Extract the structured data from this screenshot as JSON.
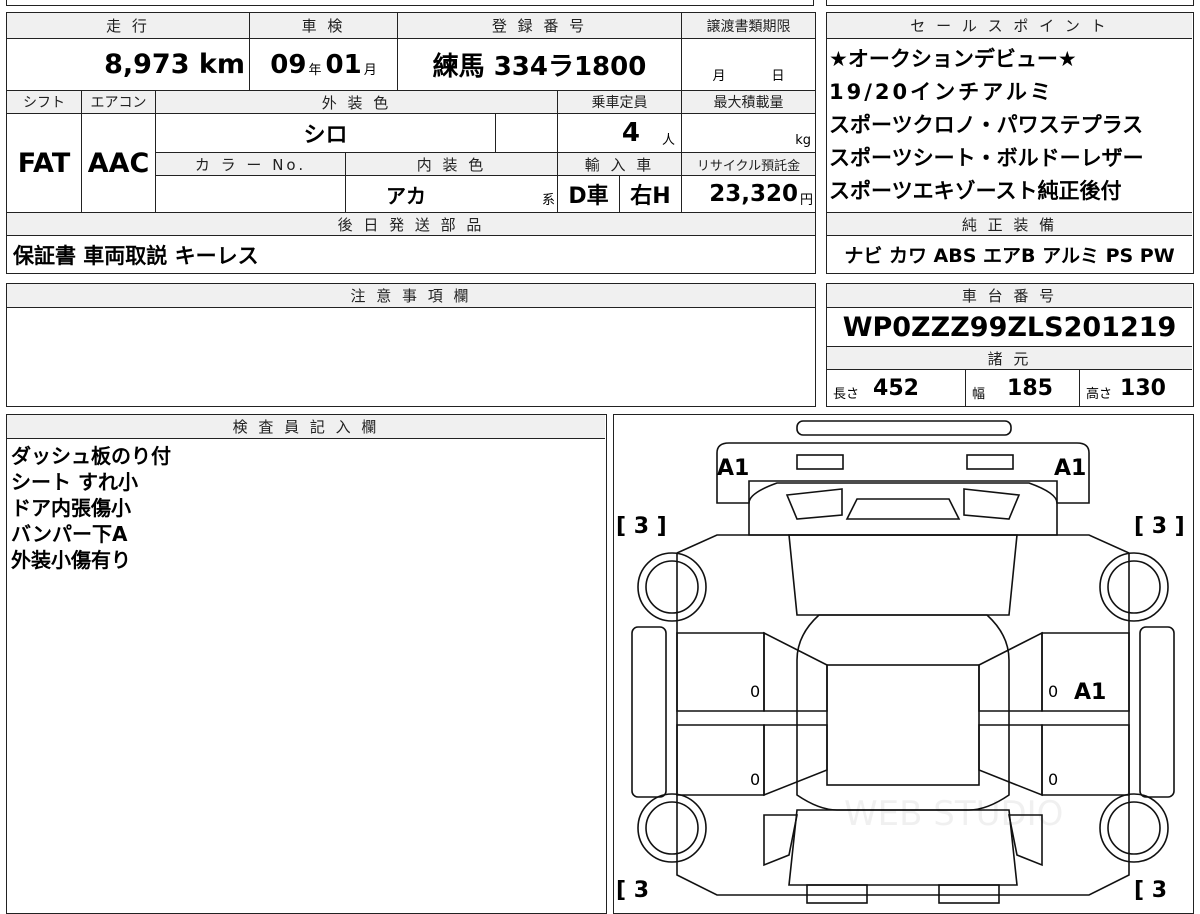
{
  "top_block": {
    "headers": {
      "mileage": "走 行",
      "shaken": "車 検",
      "registration": "登 録 番 号",
      "transfer_deadline": "譲渡書類期限",
      "shift": "シフト",
      "aircon": "エアコン",
      "exterior_color": "外 装 色",
      "capacity": "乗車定員",
      "max_load": "最大積載量",
      "color_no": "カ ラ ー No.",
      "interior_color": "内 装 色",
      "import": "輸 入 車",
      "recycle_fee": "リサイクル預託金",
      "accessories": "後 日 発 送 部 品"
    },
    "values": {
      "mileage": "8,973 km",
      "shaken_year": "09",
      "shaken_year_unit": "年",
      "shaken_month": "01",
      "shaken_month_unit": "月",
      "registration_number": "練馬 334ラ1800",
      "transfer_month_unit": "月",
      "transfer_day_unit": "日",
      "shift": "FAT",
      "aircon": "AAC",
      "exterior_color": "シロ",
      "capacity": "4",
      "capacity_unit": "人",
      "max_load_unit": "kg",
      "interior_color": "アカ",
      "interior_suffix": "系",
      "import_type": "D車",
      "steering": "右H",
      "recycle_fee": "23,320",
      "recycle_unit": "円",
      "accessories": "保証書 車両取説 キーレス"
    }
  },
  "sales_points": {
    "header": "セ ー ル ス ポ イ ン ト",
    "items": [
      "★オークションデビュー★",
      "19/20インチアルミ",
      "スポーツクロノ・パワステプラス",
      "スポーツシート・ボルドーレザー",
      "スポーツエキゾースト純正後付"
    ]
  },
  "genuine_equipment": {
    "header": "純 正 装 備",
    "value": "ナビ カワ ABS エアB アルミ PS PW"
  },
  "notes": {
    "header": "注 意 事 項 欄",
    "content": ""
  },
  "chassis": {
    "header": "車 台 番 号",
    "value": "WP0ZZZ99ZLS201219"
  },
  "specs": {
    "header": "諸 元",
    "length_label": "長さ",
    "length": "452",
    "width_label": "幅",
    "width": "185",
    "height_label": "高さ",
    "height": "130"
  },
  "inspector": {
    "header": "検 査 員 記 入 欄",
    "lines": [
      "ダッシュ板のり付",
      "シート すれ小",
      "ドア内張傷小",
      "バンパー下A",
      "外装小傷有り"
    ]
  },
  "diagram": {
    "front_left_mark": "A1",
    "front_right_mark": "A1",
    "tread_front_left": "[ 3 ]",
    "tread_front_right": "[ 3 ]",
    "tread_rear_left": "[ 3",
    "tread_rear_right": "[ 3",
    "door_fl": "0",
    "door_fr": "0",
    "door_fr_mark": "A1",
    "door_rl": "0",
    "door_rr": "0",
    "watermark": "WEB STUDIO"
  }
}
